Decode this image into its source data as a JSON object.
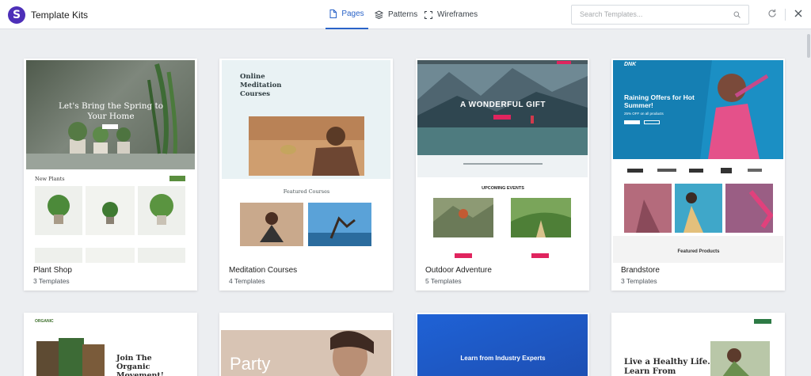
{
  "header": {
    "app_title": "Template Kits",
    "tabs": [
      {
        "label": "Pages",
        "active": true
      },
      {
        "label": "Patterns",
        "active": false
      },
      {
        "label": "Wireframes",
        "active": false
      }
    ],
    "search_placeholder": "Search Templates...",
    "accent_color": "#2a63c8",
    "logo_color": "#4d2fb8"
  },
  "kits": [
    {
      "name": "Plant Shop",
      "count": "3 Templates",
      "preview": {
        "heading": "Let's Bring the Spring to Your Home",
        "section": "New Plants"
      }
    },
    {
      "name": "Meditation Courses",
      "count": "4 Templates",
      "preview": {
        "heading": "Online Meditation Courses",
        "section": "Featured Courses"
      }
    },
    {
      "name": "Outdoor Adventure",
      "count": "5 Templates",
      "preview": {
        "heading": "A WONDERFUL GIFT",
        "section": "UPCOMING EVENTS"
      }
    },
    {
      "name": "Brandstore",
      "count": "3 Templates",
      "preview": {
        "brand": "DNK",
        "heading": "Raining Offers for Hot Summer!",
        "sub": "25% OFF on all products",
        "section": "Featured Products"
      }
    },
    {
      "name": "",
      "count": "",
      "preview": {
        "brand": "ORGANIC",
        "heading": "Join The Organic Movement!"
      }
    },
    {
      "name": "",
      "count": "",
      "preview": {
        "heading": "Party"
      }
    },
    {
      "name": "",
      "count": "",
      "preview": {
        "heading": "Learn from Industry Experts"
      }
    },
    {
      "name": "",
      "count": "",
      "preview": {
        "heading": "Live a Healthy Life. Learn From"
      }
    }
  ]
}
